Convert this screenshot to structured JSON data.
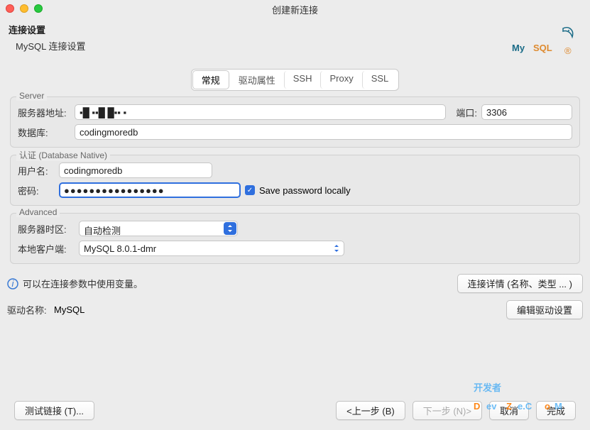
{
  "window": {
    "title": "创建新连接"
  },
  "header": {
    "title": "连接设置",
    "subtitle": "MySQL 连接设置"
  },
  "tabs": {
    "items": [
      "常规",
      "驱动属性",
      "SSH",
      "Proxy",
      "SSL"
    ],
    "active": 0
  },
  "sections": {
    "server": {
      "legend": "Server",
      "host_label": "服务器地址:",
      "host_value": "▪█ ▪▪█ █▪▪ ▪",
      "port_label": "端口:",
      "port_value": "3306",
      "db_label": "数据库:",
      "db_value": "codingmoredb"
    },
    "auth": {
      "legend": "认证 (Database Native)",
      "user_label": "用户名:",
      "user_value": "codingmoredb",
      "pass_label": "密码:",
      "pass_value": "●●●●●●●●●●●●●●●●",
      "save_label": "Save password locally",
      "save_checked": true
    },
    "advanced": {
      "legend": "Advanced",
      "tz_label": "服务器时区:",
      "tz_value": "自动检测",
      "client_label": "本地客户端:",
      "client_value": "MySQL 8.0.1-dmr"
    }
  },
  "info": {
    "text": "可以在连接参数中使用变量。",
    "detail_btn": "连接详情 (名称、类型 ... )"
  },
  "driver": {
    "label": "驱动名称:",
    "value": "MySQL",
    "edit_btn": "编辑驱动设置"
  },
  "footer": {
    "test": "测试链接 (T)...",
    "back": "<上一步 (B)",
    "next": "下一步 (N)>",
    "cancel": "取消",
    "finish": "完成"
  },
  "brand": {
    "name": "MySQL"
  }
}
